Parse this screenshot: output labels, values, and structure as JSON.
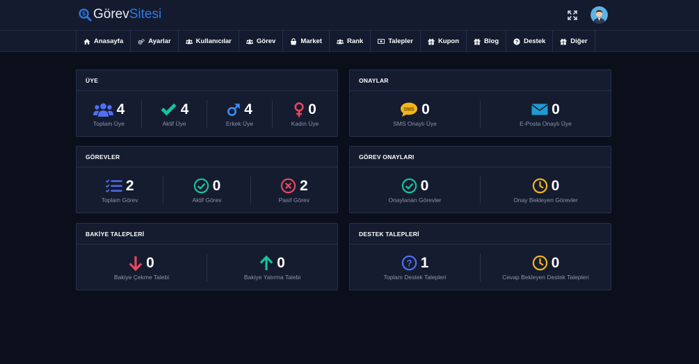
{
  "brand": {
    "part1": "Görev",
    "part2": "Sitesi"
  },
  "nav": [
    {
      "label": "Anasayfa",
      "icon": "home-icon"
    },
    {
      "label": "Ayarlar",
      "icon": "cogs-icon"
    },
    {
      "label": "Kullanıcılar",
      "icon": "users-icon"
    },
    {
      "label": "Görev",
      "icon": "users-icon"
    },
    {
      "label": "Market",
      "icon": "shopping-bag-icon"
    },
    {
      "label": "Rank",
      "icon": "users-icon"
    },
    {
      "label": "Talepler",
      "icon": "money-icon"
    },
    {
      "label": "Kupon",
      "icon": "gift-icon"
    },
    {
      "label": "Blog",
      "icon": "gift-icon"
    },
    {
      "label": "Destek",
      "icon": "question-circle-icon"
    },
    {
      "label": "Diğer",
      "icon": "gift-icon"
    }
  ],
  "cards": {
    "uye": {
      "title": "ÜYE",
      "stats": [
        {
          "value": "4",
          "label": "Toplam Üye",
          "icon": "users-icon",
          "color": "#4f6ff0"
        },
        {
          "value": "4",
          "label": "Aktif Üye",
          "icon": "check-icon",
          "color": "#17c39b"
        },
        {
          "value": "4",
          "label": "Erkek Üye",
          "icon": "mars-icon",
          "color": "#3a8df0"
        },
        {
          "value": "0",
          "label": "Kadın Üye",
          "icon": "venus-icon",
          "color": "#e8475f"
        }
      ]
    },
    "onaylar": {
      "title": "ONAYLAR",
      "stats": [
        {
          "value": "0",
          "label": "SMS Onaylı Üye",
          "icon": "sms-icon",
          "color": "#f2b51c",
          "icon_text": "SMS"
        },
        {
          "value": "0",
          "label": "E-Posta Onaylı Üye",
          "icon": "envelope-icon",
          "color": "#1f9bd1"
        }
      ]
    },
    "gorevler": {
      "title": "GÖREVLER",
      "stats": [
        {
          "value": "2",
          "label": "Toplam Görev",
          "icon": "task-list-icon",
          "color": "#4f6ff0"
        },
        {
          "value": "0",
          "label": "Aktif Görev",
          "icon": "check-circle-icon",
          "color": "#17c39b"
        },
        {
          "value": "2",
          "label": "Pasif Görev",
          "icon": "times-circle-icon",
          "color": "#e8475f"
        }
      ]
    },
    "gorev_onaylari": {
      "title": "GÖREV ONAYLARI",
      "stats": [
        {
          "value": "0",
          "label": "Onaylanan Görevler",
          "icon": "check-circle-icon",
          "color": "#17c39b"
        },
        {
          "value": "0",
          "label": "Onay Bekleyen Görevler",
          "icon": "clock-icon",
          "color": "#f2b51c"
        }
      ]
    },
    "bakiye": {
      "title": "BAKİYE TALEPLERİ",
      "stats": [
        {
          "value": "0",
          "label": "Bakiye Çekme Talebi",
          "icon": "arrow-down-icon",
          "color": "#e8475f"
        },
        {
          "value": "0",
          "label": "Bakiye Yatırma Talebi",
          "icon": "arrow-up-icon",
          "color": "#17c39b"
        }
      ]
    },
    "destek": {
      "title": "DESTEK TALEPLERİ",
      "stats": [
        {
          "value": "1",
          "label": "Toplam Destek Talepleri",
          "icon": "question-circle-icon",
          "color": "#4f6ff0"
        },
        {
          "value": "0",
          "label": "Cevap Bekleyen Destek Talepleri",
          "icon": "clock-icon",
          "color": "#f2b51c"
        }
      ]
    }
  }
}
